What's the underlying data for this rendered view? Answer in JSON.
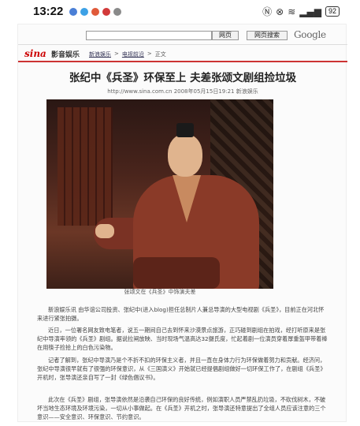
{
  "status_bar": {
    "time": "13:22",
    "battery": "92",
    "app_icon_colors": [
      "#4a7fd6",
      "#3da1e6",
      "#e05a3a",
      "#d23a3a",
      "#8a8a8a"
    ]
  },
  "browser": {
    "web_button": "网页",
    "search_button": "网页搜索",
    "search_logo": "Google"
  },
  "site": {
    "logo": "sina",
    "channel": "影音娱乐",
    "breadcrumb": [
      "新浪娱乐",
      "电视前沿",
      "正文"
    ]
  },
  "article": {
    "headline": "张纪中《兵圣》环保至上 夫差张颂文剧组捡垃圾",
    "meta": "http://www.sina.com.cn 2008年05月15日19:21 新浪娱乐",
    "photo_caption": "张颂文在《兵圣》中饰演夫差",
    "paragraphs": [
      "新浪娱乐讯 由华谊公司投资、张纪中(进入blog)担任总制片人兼总导演的大型电视剧《兵圣》，目前正在河北怀来进行紧张拍摄。",
      "近日，一位署名网友致电笔者，说五一期间自己去到怀来沙漠景点旅游，正巧碰到剧组在拍戏，经打听原来是张纪中导演率领的《兵圣》剧组。据说拉闸放映、当时现场气温高达32摄氏度，忙起着剧一位演员穿着厚重盔甲带着棒在用筷子捡拾上的白色污染物。",
      "记者了解到，张纪中导演乃是个不折不扣的环保主义者，并且一直在身体力行为环保做着努力和贡献。经济问，张纪中导演很早就有了很强的环保意识，从《三国演义》开始就已经提倡剧组做好一切环保工作了，在剧组《兵圣》开机时，张导演还亲自写了一封《绿色倡议书》。",
      "此次在《兵圣》剧组，张导演依然是沿袭自己环保的良好传统，例如演职人员严禁乱扔垃圾，不砍伐树木，不破坏当地生态环境及环境污染，一切从小事做起。在《兵圣》开机之时，张导演还特意提出了全组人员应该注意的三个意识——安全意识、环保意识、节约意识。"
    ]
  }
}
